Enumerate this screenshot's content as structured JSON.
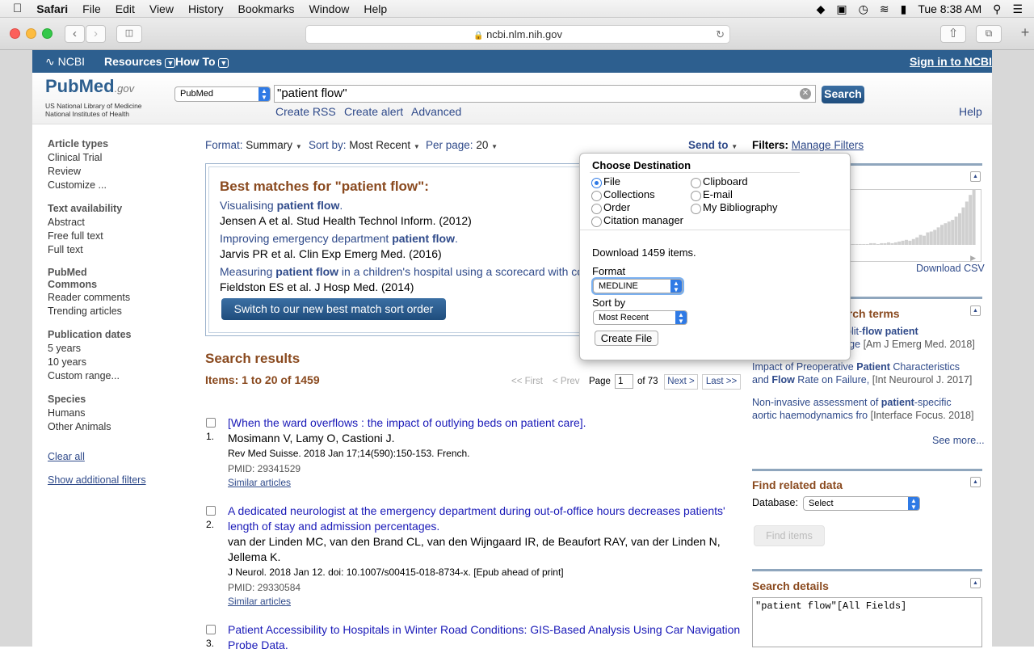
{
  "menubar": {
    "app": "Safari",
    "items": [
      "File",
      "Edit",
      "View",
      "History",
      "Bookmarks",
      "Window",
      "Help"
    ],
    "clock": "Tue 8:38 AM"
  },
  "browser": {
    "url": "ncbi.nlm.nih.gov"
  },
  "ncbi": {
    "logo": "NCBI",
    "resources": "Resources",
    "howto": "How To",
    "signin": "Sign in to NCBI"
  },
  "header": {
    "logo_pub": "Pub",
    "logo_med": "Med",
    "logo_gov": ".gov",
    "lib1": "US National Library of Medicine",
    "lib2": "National Institutes of Health",
    "db": "PubMed",
    "query": "\"patient flow\"",
    "search": "Search",
    "rss": "Create RSS",
    "alert": "Create alert",
    "advanced": "Advanced",
    "help": "Help"
  },
  "sidebar": {
    "article_types": "Article types",
    "at": [
      "Clinical Trial",
      "Review",
      "Customize ..."
    ],
    "text_avail": "Text availability",
    "ta": [
      "Abstract",
      "Free full text",
      "Full text"
    ],
    "commons1": "PubMed",
    "commons2": "Commons",
    "pc": [
      "Reader comments",
      "Trending articles"
    ],
    "pubdates": "Publication dates",
    "pd": [
      "5 years",
      "10 years",
      "Custom range..."
    ],
    "species": "Species",
    "sp": [
      "Humans",
      "Other Animals"
    ],
    "clear": "Clear all",
    "more": "Show additional filters"
  },
  "display": {
    "format_l": "Format",
    "format_v": "Summary",
    "sort_l": "Sort by",
    "sort_v": "Most Recent",
    "per_l": "Per page",
    "per_v": "20",
    "sendto": "Send to",
    "filters": "Filters:",
    "manage": "Manage Filters"
  },
  "best": {
    "title": "Best matches for \"patient flow\":",
    "m1a": "Visualising ",
    "m1b": "patient flow",
    "m1c": ".",
    "m1d": "Jensen A et al. Stud Health Technol Inform. (2012)",
    "m2a": "Improving emergency department ",
    "m2b": "patient flow",
    "m2c": ".",
    "m2d": "Jarvis PR et al. Clin Exp Emerg Med. (2016)",
    "m3a": "Measuring ",
    "m3b": "patient flow",
    "m3c": " in a children's hospital using a scorecard with co",
    "m3d": "Fieldston ES et al. J Hosp Med. (2014)",
    "switch": "Switch to our new best match sort order"
  },
  "results": {
    "title": "Search results",
    "items": "Items: 1 to 20 of 1459",
    "first": "<< First",
    "prev": "< Prev",
    "page": "Page",
    "pagenum": "1",
    "of": "of 73",
    "next": "Next >",
    "last": "Last >>",
    "r1": {
      "num": "1.",
      "title": "[When the ward overflows : the impact of outlying beds on patient care].",
      "authors": "Mosimann V, Lamy O, Castioni J.",
      "journal": "Rev Med Suisse. 2018 Jan 17;14(590):150-153. French.",
      "pmid": "PMID: 29341529",
      "similar": "Similar articles"
    },
    "r2": {
      "num": "2.",
      "title1": "A dedicated neurologist at the emergency department during out-of-office hours decreases patients'",
      "title2": "length of stay and admission percentages.",
      "authors1": "van der Linden MC, van den Brand CL, van den Wijngaard IR, de Beaufort RAY, van der Linden N,",
      "authors2": "Jellema K.",
      "journal": "J Neurol. 2018 Jan 12. doi: 10.1007/s00415-018-8734-x. [Epub ahead of print]",
      "pmid": "PMID: 29330584",
      "similar": "Similar articles"
    },
    "r3": {
      "num": "3.",
      "title1": "Patient Accessibility to Hospitals in Winter Road Conditions: GIS-Based Analysis Using Car Navigation",
      "title2": "Probe Data."
    }
  },
  "right": {
    "csv": "Download CSV",
    "terms": "arch terms",
    "t1a": "plit-",
    "t1b": "flow",
    "t1c": " ",
    "t1d": "patient",
    "t1e": "rge",
    "t1f": "[Am J Emerg Med. 2018]",
    "t2a": "Impact of Preoperative ",
    "t2b": "Patient",
    "t2c": " Characteristics",
    "t2d": "and ",
    "t2e": "Flow",
    "t2f": " Rate on Failure,",
    "t2g": "[Int Neurourol J. 2017]",
    "t3a": "Non-invasive assessment of ",
    "t3b": "patient",
    "t3c": "-specific",
    "t3d": "aortic haemodynamics fro",
    "t3e": "[Interface Focus. 2018]",
    "seemore": "See more...",
    "related": "Find related data",
    "database": "Database:",
    "dbsel": "Select",
    "finditems": "Find items",
    "details": "Search details",
    "detailsq": "\"patient flow\"[All Fields]"
  },
  "popup": {
    "title": "Choose Destination",
    "file": "File",
    "clipboard": "Clipboard",
    "collections": "Collections",
    "email": "E-mail",
    "order": "Order",
    "biblio": "My Bibliography",
    "citation": "Citation manager",
    "download": "Download 1459 items.",
    "format": "Format",
    "formatv": "MEDLINE",
    "sortby": "Sort by",
    "sortv": "Most Recent",
    "create": "Create File"
  },
  "colors": {
    "ncbi_bar": "#2d5f8f",
    "brown": "#8a4a1f",
    "link": "#2f4a8a"
  },
  "chart_bars": [
    1,
    1,
    1,
    1,
    1,
    1,
    2,
    2,
    1,
    2,
    2,
    3,
    2,
    3,
    4,
    5,
    6,
    5,
    7,
    9,
    12,
    11,
    15,
    16,
    18,
    21,
    24,
    26,
    28,
    30,
    34,
    38,
    45,
    52,
    60,
    66
  ]
}
